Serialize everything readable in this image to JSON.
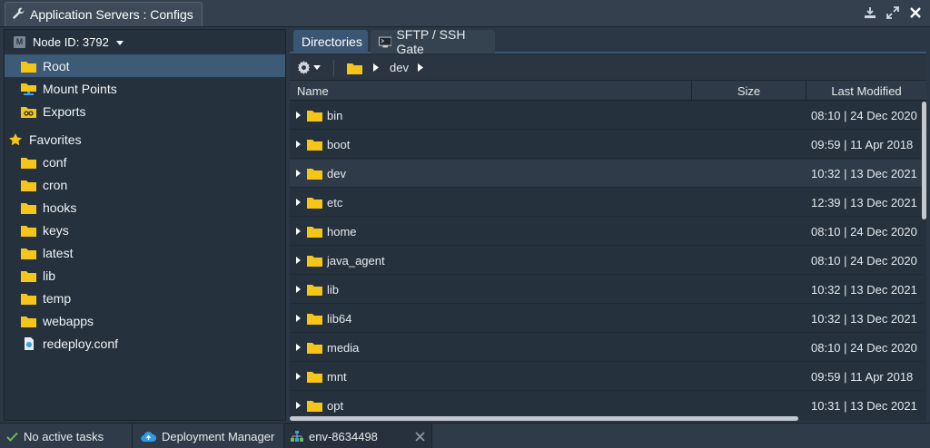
{
  "window": {
    "title": "Application Servers : Configs"
  },
  "left": {
    "node_label": "Node ID: 3792",
    "root_items": [
      {
        "label": "Root",
        "icon": "folder-icon",
        "selected": true
      },
      {
        "label": "Mount Points",
        "icon": "mount-points-icon"
      },
      {
        "label": "Exports",
        "icon": "exports-icon"
      }
    ],
    "favorites_label": "Favorites",
    "favorites": [
      {
        "label": "conf",
        "icon": "folder-icon"
      },
      {
        "label": "cron",
        "icon": "folder-icon"
      },
      {
        "label": "hooks",
        "icon": "folder-icon"
      },
      {
        "label": "keys",
        "icon": "folder-icon"
      },
      {
        "label": "latest",
        "icon": "folder-icon"
      },
      {
        "label": "lib",
        "icon": "folder-icon"
      },
      {
        "label": "temp",
        "icon": "folder-icon"
      },
      {
        "label": "webapps",
        "icon": "folder-icon"
      },
      {
        "label": "redeploy.conf",
        "icon": "file-icon"
      }
    ]
  },
  "tabs": [
    {
      "label": "Directories",
      "active": true
    },
    {
      "label": "SFTP / SSH Gate",
      "active": false
    }
  ],
  "breadcrumb": {
    "current": "dev"
  },
  "columns": {
    "name": "Name",
    "size": "Size",
    "modified": "Last Modified"
  },
  "rows": [
    {
      "name": "bin",
      "modified": "08:10 | 24 Dec 2020"
    },
    {
      "name": "boot",
      "modified": "09:59 | 11 Apr 2018"
    },
    {
      "name": "dev",
      "modified": "10:32 | 13 Dec 2021",
      "highlight": true
    },
    {
      "name": "etc",
      "modified": "12:39 | 13 Dec 2021"
    },
    {
      "name": "home",
      "modified": "08:10 | 24 Dec 2020"
    },
    {
      "name": "java_agent",
      "modified": "08:10 | 24 Dec 2020"
    },
    {
      "name": "lib",
      "modified": "10:32 | 13 Dec 2021"
    },
    {
      "name": "lib64",
      "modified": "10:32 | 13 Dec 2021"
    },
    {
      "name": "media",
      "modified": "08:10 | 24 Dec 2020"
    },
    {
      "name": "mnt",
      "modified": "09:59 | 11 Apr 2018"
    },
    {
      "name": "opt",
      "modified": "10:31 | 13 Dec 2021"
    }
  ],
  "statusbar": {
    "tasks": "No active tasks",
    "deployment_manager": "Deployment Manager",
    "env": "env-8634498"
  },
  "colors": {
    "folder": "#f5c518",
    "selected": "#3d5a76",
    "accent": "#3b5672",
    "ok": "#6cc04a"
  }
}
